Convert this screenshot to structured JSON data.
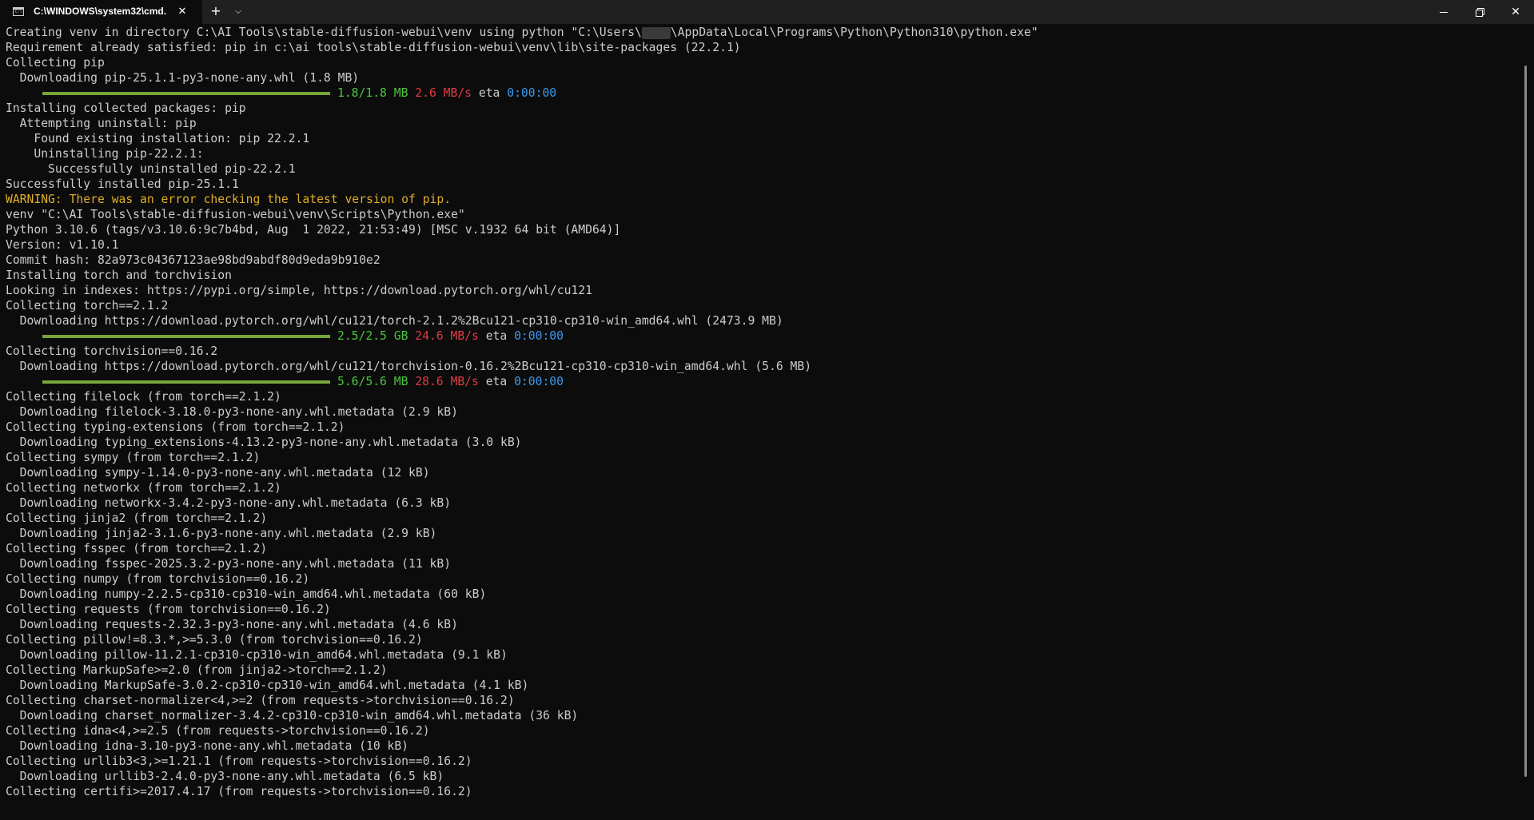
{
  "window": {
    "tab_title": "C:\\WINDOWS\\system32\\cmd.",
    "tab_icon": "cmd-icon",
    "close_tab_glyph": "✕",
    "new_tab_glyph": "+",
    "dropdown_glyph": "⌵",
    "close_glyph": "✕"
  },
  "colors": {
    "background": "#0c0c0c",
    "text": "#cccccc",
    "warning": "#e0ad27",
    "progress_bar": "#76a63a",
    "size": "#4cc43f",
    "speed": "#e03a44",
    "eta": "#3b9af0"
  },
  "terminal": {
    "line01a": "Creating venv in directory C:\\AI Tools\\stable-diffusion-webui\\venv using python \"C:\\Users\\",
    "line01b": "\\AppData\\Local\\Programs\\Python\\Python310\\python.exe\"",
    "line02": "Requirement already satisfied: pip in c:\\ai tools\\stable-diffusion-webui\\venv\\lib\\site-packages (22.2.1)",
    "line03": "Collecting pip",
    "line04": "  Downloading pip-25.1.1-py3-none-any.whl (1.8 MB)",
    "progress1": {
      "fraction": 1.0,
      "size": "1.8/1.8 MB",
      "speed": "2.6 MB/s",
      "eta_label": "eta",
      "eta": "0:00:00"
    },
    "line06": "Installing collected packages: pip",
    "line07": "  Attempting uninstall: pip",
    "line08": "    Found existing installation: pip 22.2.1",
    "line09": "    Uninstalling pip-22.2.1:",
    "line10": "      Successfully uninstalled pip-22.2.1",
    "line11": "Successfully installed pip-25.1.1",
    "line12": "WARNING: There was an error checking the latest version of pip.",
    "line13": "venv \"C:\\AI Tools\\stable-diffusion-webui\\venv\\Scripts\\Python.exe\"",
    "line14": "Python 3.10.6 (tags/v3.10.6:9c7b4bd, Aug  1 2022, 21:53:49) [MSC v.1932 64 bit (AMD64)]",
    "line15": "Version: v1.10.1",
    "line16": "Commit hash: 82a973c04367123ae98bd9abdf80d9eda9b910e2",
    "line17": "Installing torch and torchvision",
    "line18": "Looking in indexes: https://pypi.org/simple, https://download.pytorch.org/whl/cu121",
    "line19": "Collecting torch==2.1.2",
    "line20": "  Downloading https://download.pytorch.org/whl/cu121/torch-2.1.2%2Bcu121-cp310-cp310-win_amd64.whl (2473.9 MB)",
    "progress2": {
      "fraction": 1.0,
      "size": "2.5/2.5 GB",
      "speed": "24.6 MB/s",
      "eta_label": "eta",
      "eta": "0:00:00"
    },
    "line22": "Collecting torchvision==0.16.2",
    "line23": "  Downloading https://download.pytorch.org/whl/cu121/torchvision-0.16.2%2Bcu121-cp310-cp310-win_amd64.whl (5.6 MB)",
    "progress3": {
      "fraction": 1.0,
      "size": "5.6/5.6 MB",
      "speed": "28.6 MB/s",
      "eta_label": "eta",
      "eta": "0:00:00"
    },
    "line25": "Collecting filelock (from torch==2.1.2)",
    "line26": "  Downloading filelock-3.18.0-py3-none-any.whl.metadata (2.9 kB)",
    "line27": "Collecting typing-extensions (from torch==2.1.2)",
    "line28": "  Downloading typing_extensions-4.13.2-py3-none-any.whl.metadata (3.0 kB)",
    "line29": "Collecting sympy (from torch==2.1.2)",
    "line30": "  Downloading sympy-1.14.0-py3-none-any.whl.metadata (12 kB)",
    "line31": "Collecting networkx (from torch==2.1.2)",
    "line32": "  Downloading networkx-3.4.2-py3-none-any.whl.metadata (6.3 kB)",
    "line33": "Collecting jinja2 (from torch==2.1.2)",
    "line34": "  Downloading jinja2-3.1.6-py3-none-any.whl.metadata (2.9 kB)",
    "line35": "Collecting fsspec (from torch==2.1.2)",
    "line36": "  Downloading fsspec-2025.3.2-py3-none-any.whl.metadata (11 kB)",
    "line37": "Collecting numpy (from torchvision==0.16.2)",
    "line38": "  Downloading numpy-2.2.5-cp310-cp310-win_amd64.whl.metadata (60 kB)",
    "line39": "Collecting requests (from torchvision==0.16.2)",
    "line40": "  Downloading requests-2.32.3-py3-none-any.whl.metadata (4.6 kB)",
    "line41": "Collecting pillow!=8.3.*,>=5.3.0 (from torchvision==0.16.2)",
    "line42": "  Downloading pillow-11.2.1-cp310-cp310-win_amd64.whl.metadata (9.1 kB)",
    "line43": "Collecting MarkupSafe>=2.0 (from jinja2->torch==2.1.2)",
    "line44": "  Downloading MarkupSafe-3.0.2-cp310-cp310-win_amd64.whl.metadata (4.1 kB)",
    "line45": "Collecting charset-normalizer<4,>=2 (from requests->torchvision==0.16.2)",
    "line46": "  Downloading charset_normalizer-3.4.2-cp310-cp310-win_amd64.whl.metadata (36 kB)",
    "line47": "Collecting idna<4,>=2.5 (from requests->torchvision==0.16.2)",
    "line48": "  Downloading idna-3.10-py3-none-any.whl.metadata (10 kB)",
    "line49": "Collecting urllib3<3,>=1.21.1 (from requests->torchvision==0.16.2)",
    "line50": "  Downloading urllib3-2.4.0-py3-none-any.whl.metadata (6.5 kB)",
    "line51": "Collecting certifi>=2017.4.17 (from requests->torchvision==0.16.2)"
  }
}
